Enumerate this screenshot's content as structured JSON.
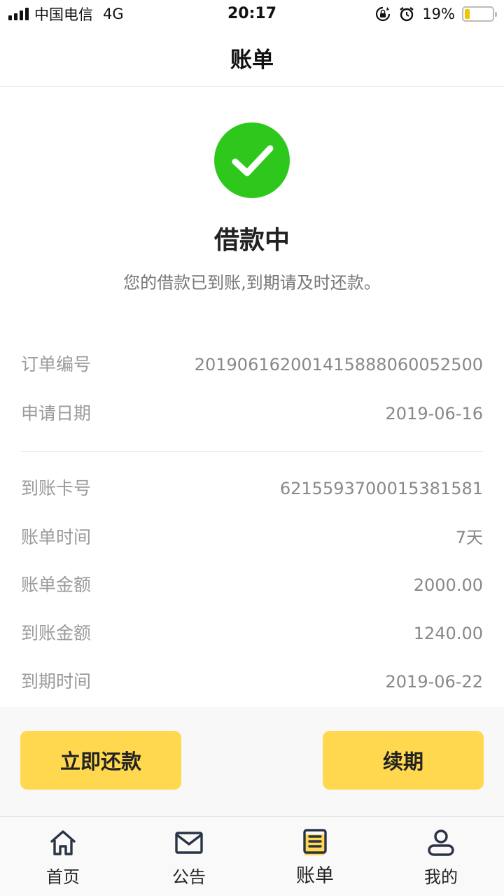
{
  "status_bar": {
    "carrier": "中国电信",
    "network": "4G",
    "time": "20:17",
    "battery_percent": "19%",
    "battery_level": 0.19,
    "icons": [
      "signal-icon",
      "rotation-lock-icon",
      "alarm-icon",
      "battery-icon"
    ]
  },
  "nav": {
    "title": "账单"
  },
  "status": {
    "icon": "check-circle-icon",
    "icon_color": "#2ec81c",
    "title": "借款中",
    "description": "您的借款已到账,到期请及时还款。"
  },
  "details": {
    "order_number": {
      "label": "订单编号",
      "value": "2019061620014158880600525​00"
    },
    "apply_date": {
      "label": "申请日期",
      "value": "2019-06-16"
    },
    "card_number": {
      "label": "到账卡号",
      "value": "6215593700015381581"
    },
    "bill_period": {
      "label": "账单时间",
      "value": "7天"
    },
    "bill_amount": {
      "label": "账单金额",
      "value": "2000.00"
    },
    "received_amount": {
      "label": "到账金额",
      "value": "1240.00"
    },
    "due_date": {
      "label": "到期时间",
      "value": "2019-06-22"
    }
  },
  "actions": {
    "repay_label": "立即还款",
    "renew_label": "续期",
    "button_color": "#ffd84f"
  },
  "tabs": [
    {
      "label": "首页",
      "icon": "home-icon"
    },
    {
      "label": "公告",
      "icon": "mail-icon"
    },
    {
      "label": "账单",
      "icon": "bill-icon",
      "active": true
    },
    {
      "label": "我的",
      "icon": "user-icon"
    }
  ]
}
